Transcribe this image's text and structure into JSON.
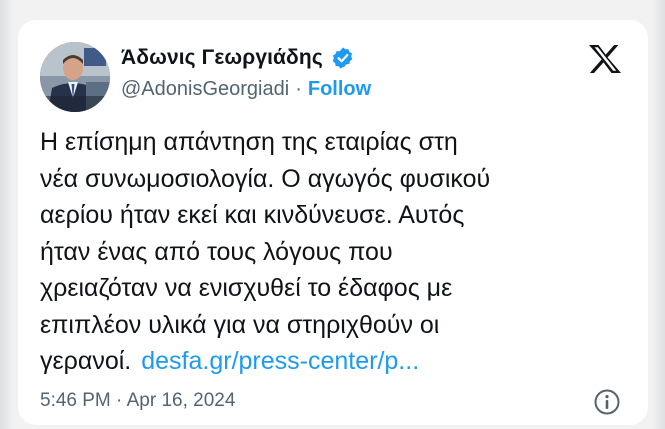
{
  "author": {
    "display_name": "Άδωνις Γεωργιάδης",
    "handle": "@AdonisGeorgiadi",
    "separator": "·",
    "follow_label": "Follow",
    "verified_icon": "verified-badge-icon",
    "avatar_icon": "profile-photo"
  },
  "platform_icon": "x-logo-icon",
  "tweet": {
    "text": "Η επίσημη απάντηση της εταιρίας στη\nνέα συνωμοσιολογία. Ο αγωγός φυσικού\nαερίου ήταν εκεί και κινδύνευσε. Αυτός\nήταν ένας από τους λόγους που\nχρειαζόταν να ενισχυθεί το έδαφος με\nεπιπλέον υλικά για να στηριχθούν οι\nγερανοί.",
    "link_text": "desfa.gr/press-center/p..."
  },
  "meta": {
    "timestamp": "5:46 PM · Apr 16, 2024",
    "info_icon": "info-icon"
  },
  "colors": {
    "accent": "#1d9bf0",
    "text": "#0f1419",
    "secondary": "#536471"
  }
}
